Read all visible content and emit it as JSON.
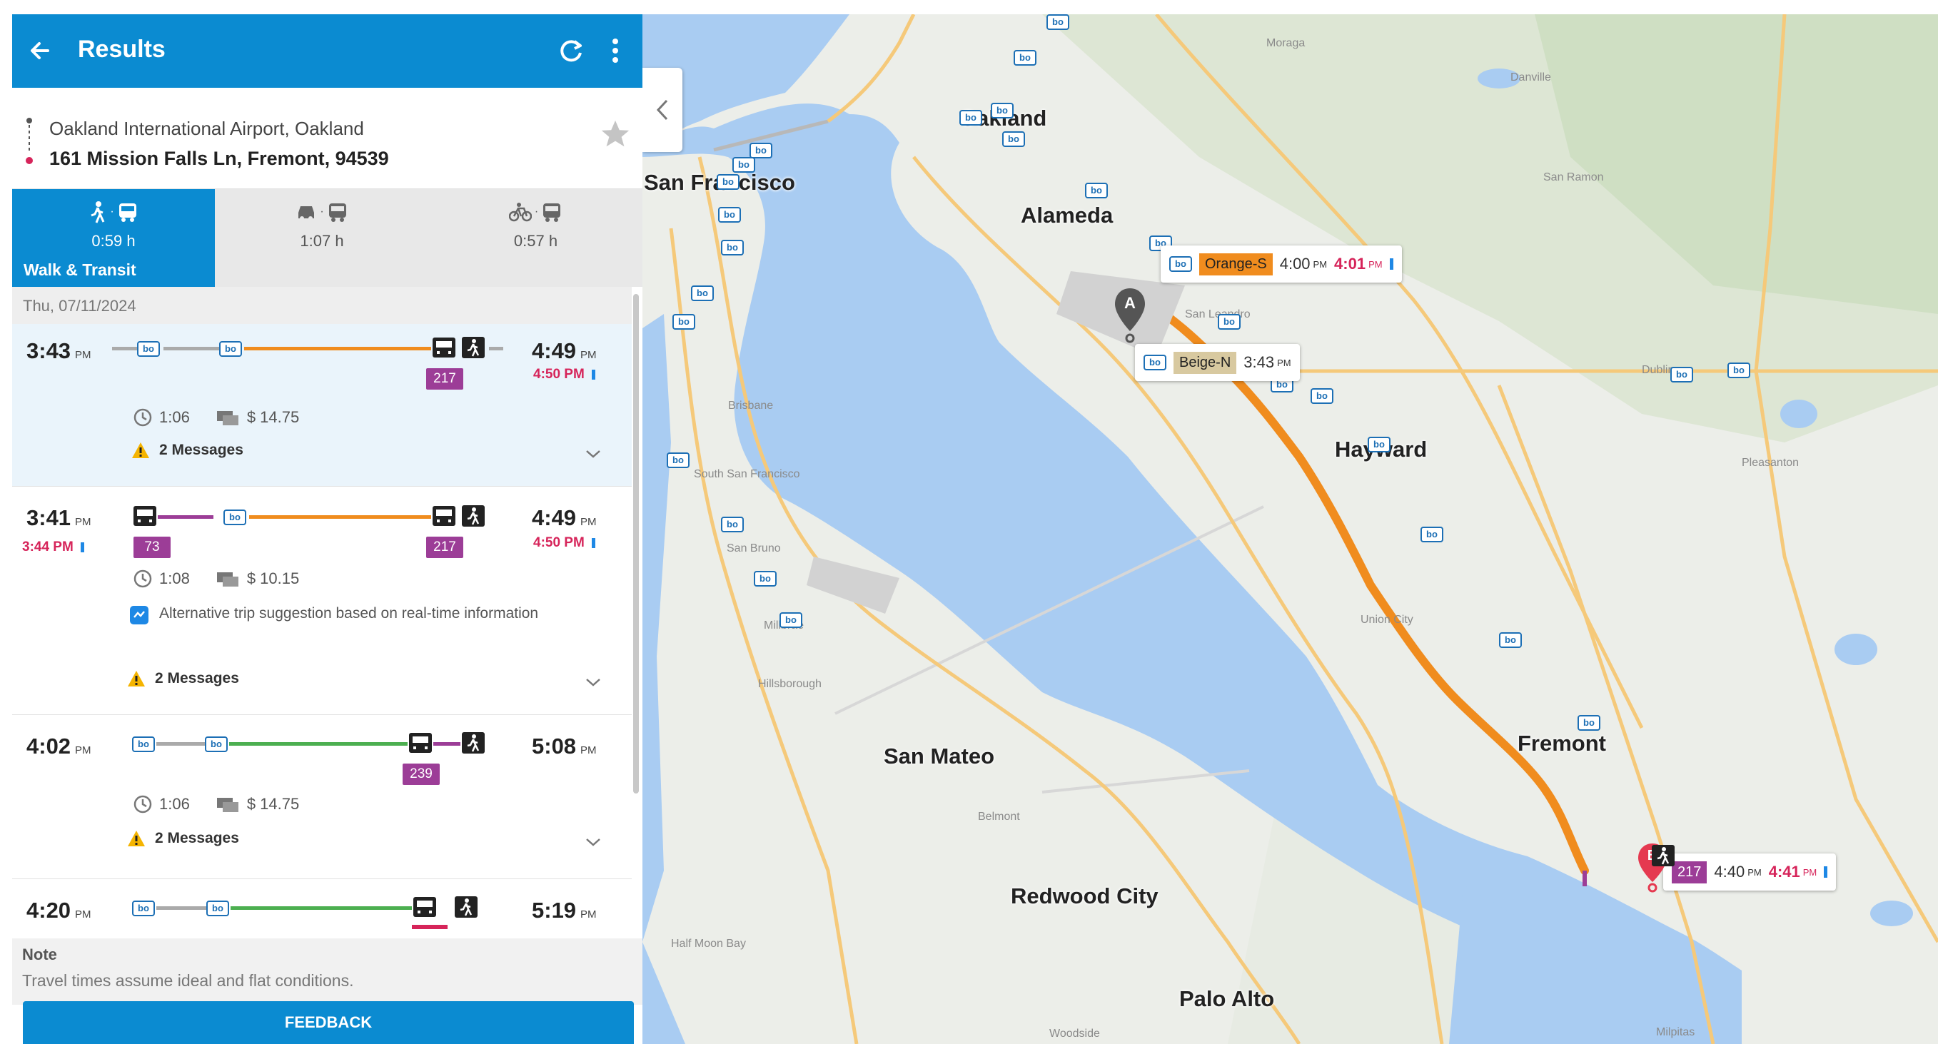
{
  "header": {
    "title": "Results"
  },
  "route": {
    "from": "Oakland International Airport, Oakland",
    "to": "161 Mission Falls Ln, Fremont, 94539"
  },
  "modes": [
    {
      "label": "Walk & Transit",
      "time": "0:59 h",
      "active": true,
      "icons": [
        "walk-icon",
        "bus-icon"
      ]
    },
    {
      "label": "",
      "time": "1:07 h",
      "active": false,
      "icons": [
        "car-icon",
        "bus-icon"
      ]
    },
    {
      "label": "",
      "time": "0:57 h",
      "active": false,
      "icons": [
        "bike-icon",
        "bus-icon"
      ]
    }
  ],
  "date": "Thu, 07/11/2024",
  "trips": [
    {
      "depart": "3:43",
      "depart_ampm": "PM",
      "depart_realtime": "",
      "arrive": "4:49",
      "arrive_ampm": "PM",
      "arrive_realtime": "4:50 PM",
      "badges": [
        "217"
      ],
      "duration": "1:06",
      "fare": "$ 14.75",
      "messages": "2 Messages",
      "alt_text": ""
    },
    {
      "depart": "3:41",
      "depart_ampm": "PM",
      "depart_realtime": "3:44 PM",
      "arrive": "4:49",
      "arrive_ampm": "PM",
      "arrive_realtime": "4:50 PM",
      "badges": [
        "73",
        "217"
      ],
      "duration": "1:08",
      "fare": "$ 10.15",
      "messages": "2 Messages",
      "alt_text": "Alternative trip suggestion based on real-time information"
    },
    {
      "depart": "4:02",
      "depart_ampm": "PM",
      "depart_realtime": "",
      "arrive": "5:08",
      "arrive_ampm": "PM",
      "arrive_realtime": "",
      "badges": [
        "239"
      ],
      "duration": "1:06",
      "fare": "$ 14.75",
      "messages": "2 Messages",
      "alt_text": ""
    },
    {
      "depart": "4:20",
      "depart_ampm": "PM",
      "depart_realtime": "",
      "arrive": "5:19",
      "arrive_ampm": "PM",
      "arrive_realtime": "",
      "badges": [],
      "duration": "",
      "fare": "",
      "messages": "",
      "alt_text": ""
    }
  ],
  "note": {
    "title": "Note",
    "body": "Travel times assume ideal and flat conditions."
  },
  "feedback_label": "FEEDBACK",
  "map": {
    "cities": [
      "San Francisco",
      "Oakland",
      "Alameda",
      "Hayward",
      "San Mateo",
      "Fremont",
      "Redwood City",
      "Palo Alto"
    ],
    "towns": [
      "Moraga",
      "Danville",
      "San Ramon",
      "Pleasanton",
      "San Leandro",
      "Brisbane",
      "South San Francisco",
      "San Bruno",
      "Millbrae",
      "Hillsborough",
      "Belmont",
      "Half Moon Bay",
      "Union City",
      "Woodside",
      "Milpitas",
      "Dublin"
    ],
    "stop_label": "bo",
    "callouts": [
      {
        "line": "Orange-S",
        "line_color": "#f08c1e",
        "time": "4:00",
        "ampm": "PM",
        "realtime": "4:01",
        "rt_ampm": "PM"
      },
      {
        "line": "Beige-N",
        "line_color": "#d8c9a0",
        "time": "3:43",
        "ampm": "PM",
        "realtime": "",
        "rt_ampm": ""
      },
      {
        "line": "217",
        "line_color": "#9c3d97",
        "time": "4:40",
        "ampm": "PM",
        "realtime": "4:41",
        "rt_ampm": "PM"
      }
    ],
    "pin_a": "A",
    "pin_b": "B",
    "route_color": "#f08c1e",
    "water_color": "#a9ccf2"
  },
  "colors": {
    "brand": "#0b8bd1",
    "realtime": "#d6245a",
    "bus_badge": "#9c3d97",
    "orange_line": "#f08c1e",
    "green_line": "#4caf50"
  }
}
